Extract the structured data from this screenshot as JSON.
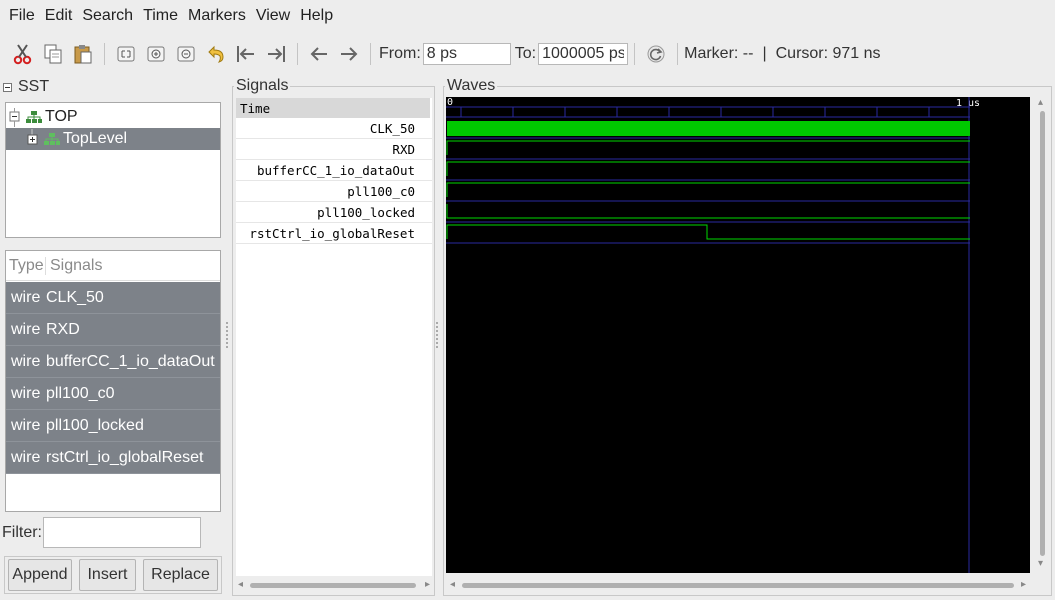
{
  "menu": [
    "File",
    "Edit",
    "Search",
    "Time",
    "Markers",
    "View",
    "Help"
  ],
  "toolbar": {
    "icons": [
      "cut-icon",
      "copy-icon",
      "paste-icon",
      "zoom-fit-icon",
      "zoom-in-icon",
      "zoom-out-icon",
      "undo-zoom-icon",
      "zoom-start-icon",
      "zoom-end-icon",
      "back-icon",
      "forward-icon"
    ],
    "from_label": "From:",
    "from_value": "8 ps",
    "to_label": "To:",
    "to_value": "1000005 ps",
    "reload_icon": "reload-icon",
    "marker_text": "Marker: --",
    "separator": "|",
    "cursor_text": "Cursor: 971 ns"
  },
  "sst": {
    "title": "SST",
    "tree": [
      {
        "label": "TOP",
        "expander": "−",
        "selected": false
      },
      {
        "label": "TopLevel",
        "expander": "+",
        "selected": true
      }
    ],
    "columns": {
      "type": "Type",
      "signals": "Signals"
    },
    "signals": [
      {
        "type": "wire",
        "name": "CLK_50"
      },
      {
        "type": "wire",
        "name": "RXD"
      },
      {
        "type": "wire",
        "name": "bufferCC_1_io_dataOut"
      },
      {
        "type": "wire",
        "name": "pll100_c0"
      },
      {
        "type": "wire",
        "name": "pll100_locked"
      },
      {
        "type": "wire",
        "name": "rstCtrl_io_globalReset"
      }
    ],
    "filter_label": "Filter:",
    "filter_value": "",
    "buttons": {
      "append": "Append",
      "insert": "Insert",
      "replace": "Replace"
    }
  },
  "signals_pane": {
    "title": "Signals",
    "time_header": "Time",
    "names": [
      "CLK_50",
      "RXD",
      "bufferCC_1_io_dataOut",
      "pll100_c0",
      "pll100_locked",
      "rstCtrl_io_globalReset"
    ]
  },
  "waves_pane": {
    "title": "Waves",
    "time_start_label": "0",
    "time_end_label": "1 us",
    "colors": {
      "background": "#000000",
      "trace": "#00d800",
      "clock_fill": "#00c800",
      "grid": "#2a2aa0"
    }
  }
}
